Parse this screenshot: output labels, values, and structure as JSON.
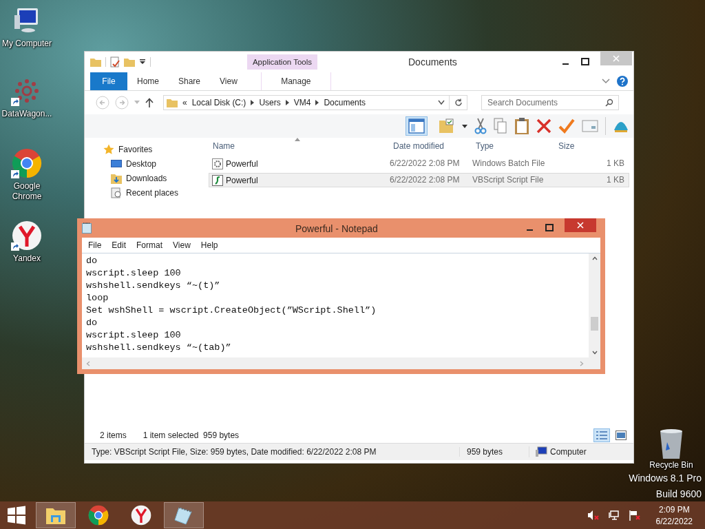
{
  "desktop_icons": [
    {
      "label": "My Computer",
      "kind": "computer",
      "shortcut": false
    },
    {
      "label": "DataWagon...",
      "kind": "datawagon",
      "shortcut": true
    },
    {
      "label": "Google Chrome",
      "kind": "chrome",
      "shortcut": true
    },
    {
      "label": "Yandex",
      "kind": "yandex",
      "shortcut": true
    }
  ],
  "explorer": {
    "title": "Documents",
    "context_tab": "Application Tools",
    "ribbon_tabs": [
      {
        "label": "File",
        "kind": "file"
      },
      {
        "label": "Home",
        "kind": "tab"
      },
      {
        "label": "Share",
        "kind": "tab"
      },
      {
        "label": "View",
        "kind": "tab"
      },
      {
        "label": "Manage",
        "kind": "context"
      }
    ],
    "address": {
      "prefix": "«",
      "segments": [
        "Local Disk (C:)",
        "Users",
        "VM4",
        "Documents"
      ]
    },
    "search": {
      "placeholder": "Search Documents"
    },
    "nav": {
      "header": "Favorites",
      "items": [
        {
          "label": "Desktop",
          "kind": "desktop"
        },
        {
          "label": "Downloads",
          "kind": "downloads"
        },
        {
          "label": "Recent places",
          "kind": "recent"
        }
      ]
    },
    "columns": [
      "Name",
      "Date modified",
      "Type",
      "Size"
    ],
    "rows": [
      {
        "name": "Powerful",
        "date": "6/22/2022 2:08 PM",
        "type": "Windows Batch File",
        "size": "1 KB",
        "kind": "batch",
        "selected": false
      },
      {
        "name": "Powerful",
        "date": "6/22/2022 2:08 PM",
        "type": "VBScript Script File",
        "size": "1 KB",
        "kind": "vbs",
        "selected": true
      }
    ],
    "status": {
      "count": "2 items",
      "selection": "1 item selected  959 bytes"
    },
    "details": {
      "info": "Type: VBScript Script File, Size: 959 bytes, Date modified: 6/22/2022 2:08 PM",
      "size": "959 bytes",
      "location": "Computer"
    }
  },
  "notepad": {
    "title": "Powerful - Notepad",
    "menu": [
      "File",
      "Edit",
      "Format",
      "View",
      "Help"
    ],
    "lines": [
      "do",
      "wscript.sleep 100",
      "wshshell.sendkeys “~(t)”",
      "loop",
      "Set wshShell = wscript.CreateObject(”WScript.Shell”)",
      "do",
      "wscript.sleep 100",
      "wshshell.sendkeys “~(tab)”"
    ]
  },
  "recycle_bin": {
    "label": "Recycle Bin"
  },
  "os_watermark": [
    "Windows 8.1 Pro",
    "Build 9600"
  ],
  "taskbar": {
    "apps": [
      {
        "kind": "explorer",
        "active": true
      },
      {
        "kind": "chrome",
        "active": false
      },
      {
        "kind": "yandex",
        "active": false
      },
      {
        "kind": "notepad",
        "active": true
      }
    ],
    "time": "2:09 PM",
    "date": "6/22/2022"
  }
}
